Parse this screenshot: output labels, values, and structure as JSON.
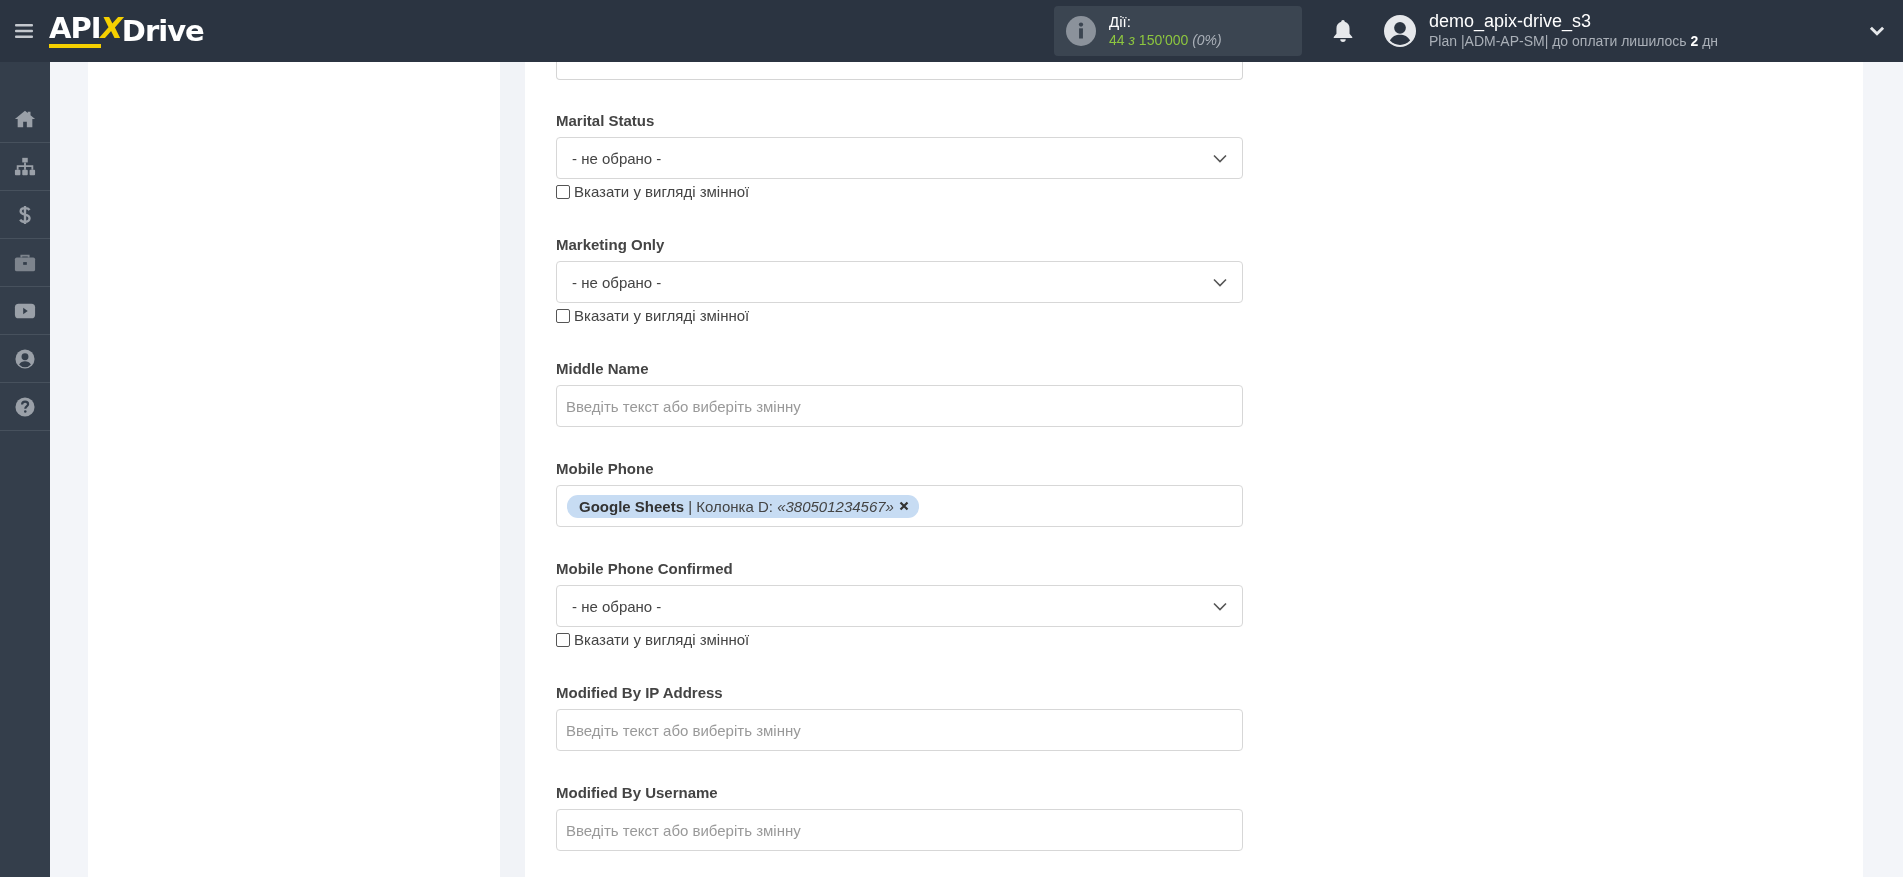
{
  "header": {
    "logo": {
      "part_a": "API",
      "part_x": "X",
      "part_b": "Drive"
    },
    "actions": {
      "label": "Дії:",
      "used": "44",
      "of": "з",
      "total": "150'000",
      "percent": "(0%)"
    },
    "user": {
      "name": "demo_apix-drive_s3",
      "plan": "Plan |ADM-AP-SM| до оплати лишилось **2** дн"
    }
  },
  "form": {
    "fields": [
      {
        "kind": "select",
        "label": "Marital Status",
        "value": "- не обрано -",
        "as_variable": {
          "label": "Вказати у вигляді змінної",
          "checked": false
        }
      },
      {
        "kind": "select",
        "label": "Marketing Only",
        "value": "- не обрано -",
        "as_variable": {
          "label": "Вказати у вигляді змінної",
          "checked": false
        }
      },
      {
        "kind": "text",
        "label": "Middle Name",
        "placeholder": "Введіть текст або виберіть змінну"
      },
      {
        "kind": "chips",
        "label": "Mobile Phone",
        "chips": [
          "**Google Sheets** | Колонка D: *«380501234567»*"
        ]
      },
      {
        "kind": "select",
        "label": "Mobile Phone Confirmed",
        "value": "- не обрано -",
        "as_variable": {
          "label": "Вказати у вигляді змінної",
          "checked": false
        }
      },
      {
        "kind": "text",
        "label": "Modified By IP Address",
        "placeholder": "Введіть текст або виберіть змінну"
      },
      {
        "kind": "text",
        "label": "Modified By Username",
        "placeholder": "Введіть текст або виберіть змінну"
      }
    ]
  }
}
